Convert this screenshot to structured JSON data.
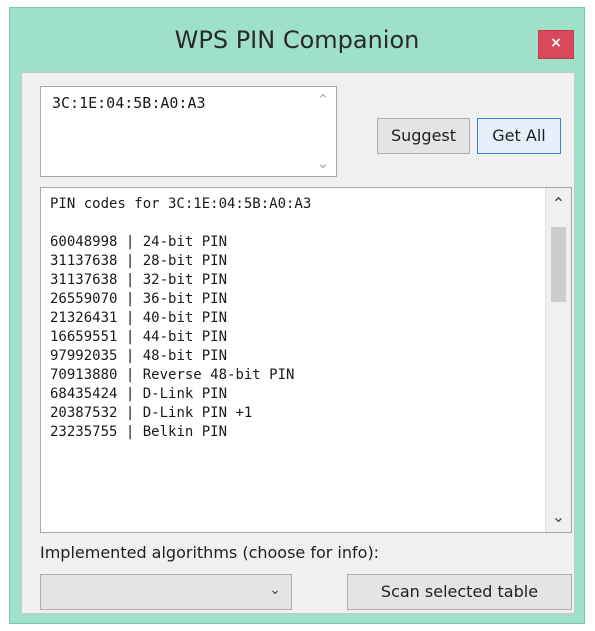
{
  "window": {
    "title": "WPS PIN Companion",
    "close_label": "×"
  },
  "mac_input": {
    "value": "3C:1E:04:5B:A0:A3"
  },
  "buttons": {
    "suggest": "Suggest",
    "get_all": "Get All",
    "scan_selected_table": "Scan selected table"
  },
  "results": {
    "header": "PIN codes for 3C:1E:04:5B:A0:A3",
    "rows": [
      {
        "pin": "60048998",
        "algo": "24-bit PIN"
      },
      {
        "pin": "31137638",
        "algo": "28-bit PIN"
      },
      {
        "pin": "31137638",
        "algo": "32-bit PIN"
      },
      {
        "pin": "26559070",
        "algo": "36-bit PIN"
      },
      {
        "pin": "21326431",
        "algo": "40-bit PIN"
      },
      {
        "pin": "16659551",
        "algo": "44-bit PIN"
      },
      {
        "pin": "97992035",
        "algo": "48-bit PIN"
      },
      {
        "pin": "70913880",
        "algo": "Reverse 48-bit PIN"
      },
      {
        "pin": "68435424",
        "algo": "D-Link PIN"
      },
      {
        "pin": "20387532",
        "algo": "D-Link PIN +1"
      },
      {
        "pin": "23235755",
        "algo": "Belkin PIN"
      }
    ]
  },
  "algorithms": {
    "label": "Implemented algorithms (choose for info):",
    "selected": ""
  },
  "icons": {
    "scroll_up": "chevron-up-icon",
    "scroll_down": "chevron-down-icon",
    "dropdown": "chevron-down-icon",
    "close": "close-icon"
  },
  "colors": {
    "window_frame": "#9ee0c8",
    "close_button": "#d8495c",
    "active_button_border": "#3c7fd4"
  }
}
